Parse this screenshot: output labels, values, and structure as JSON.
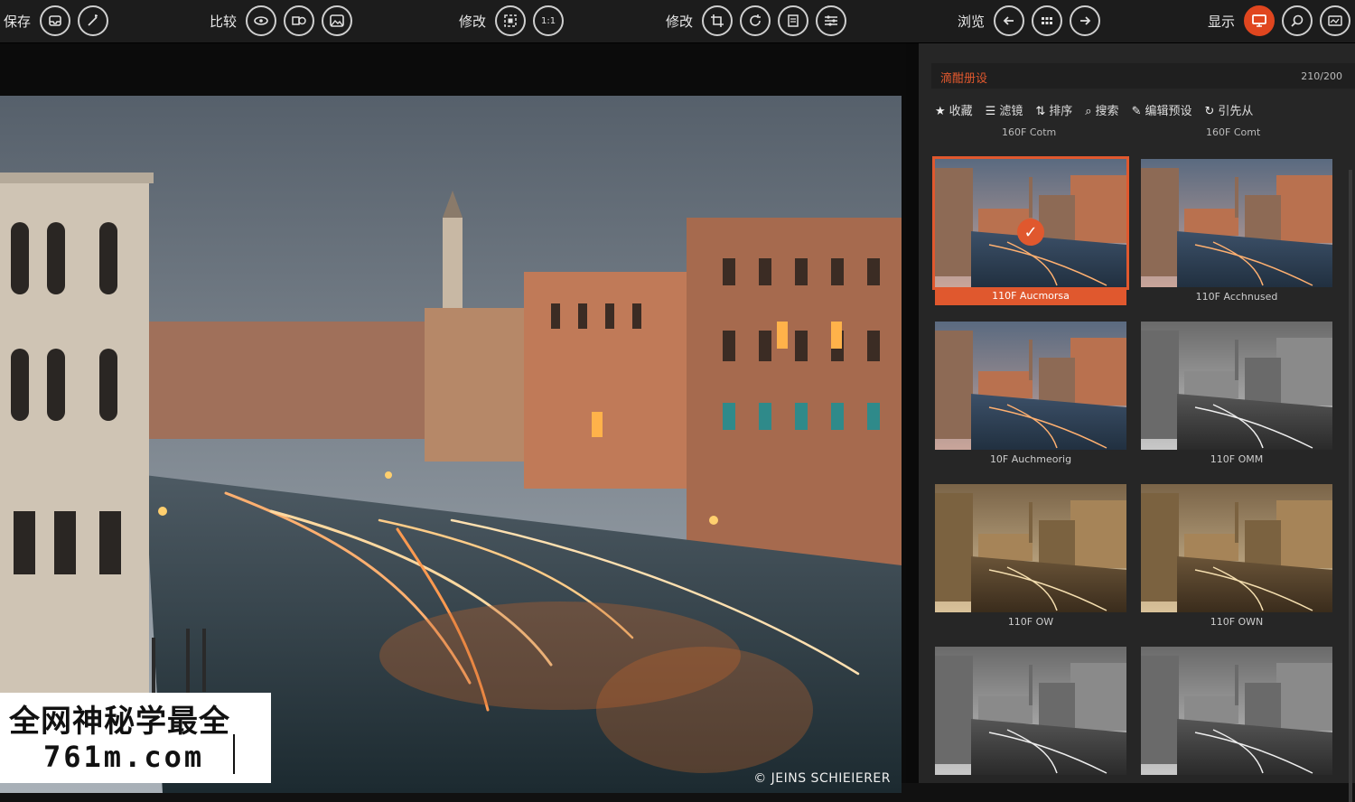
{
  "toolbar": {
    "groups": [
      {
        "label": "保存",
        "buttons": [
          "inbox-icon",
          "wand-icon"
        ]
      },
      {
        "label": "比较",
        "buttons": [
          "eye-icon",
          "compare-icon",
          "image-icon"
        ]
      },
      {
        "label": "修改",
        "buttons": [
          "crop-frame-icon",
          "ratio-icon"
        ]
      },
      {
        "label": "修改",
        "buttons": [
          "crop-icon",
          "rotate-icon",
          "layers-icon",
          "sliders-icon"
        ]
      },
      {
        "label": "浏览",
        "buttons": [
          "arrow-left-icon",
          "grid-icon",
          "arrow-right-icon"
        ]
      },
      {
        "label": "显示",
        "buttons": [
          "monitor-icon",
          "zoom-icon",
          "filmstrip-icon"
        ]
      }
    ],
    "ratio_text": "1:1"
  },
  "viewer": {
    "credit": "© JEINS SCHIEIERER"
  },
  "watermark": {
    "line1": "全网神秘学最全",
    "line2": "761m.com"
  },
  "panel": {
    "title": "滴酣册设",
    "count": "210/200",
    "filters": [
      {
        "icon": "★",
        "label": "收藏"
      },
      {
        "icon": "☰",
        "label": "滤镜"
      },
      {
        "icon": "⇅",
        "label": "排序"
      },
      {
        "icon": "⌕",
        "label": "搜索"
      },
      {
        "icon": "✎",
        "label": "编辑预设"
      },
      {
        "icon": "↻",
        "label": "引先从"
      }
    ],
    "col_labels": [
      "160F Cotm",
      "160F Comt"
    ],
    "thumbs": [
      {
        "caption": "110F Aucmorsa",
        "style": "color",
        "selected": true
      },
      {
        "caption": "110F Acchnused",
        "style": "color",
        "selected": false
      },
      {
        "caption": "10F Auchmeorig",
        "style": "color",
        "selected": false
      },
      {
        "caption": "110F OMM",
        "style": "mono",
        "selected": false
      },
      {
        "caption": "110F OW",
        "style": "sepia",
        "selected": false
      },
      {
        "caption": "110F OWN",
        "style": "sepia",
        "selected": false
      },
      {
        "caption": "",
        "style": "mono",
        "selected": false
      },
      {
        "caption": "",
        "style": "mono",
        "selected": false
      }
    ]
  },
  "colors": {
    "accent": "#e0582e",
    "toolbar_bg": "#1c1c1c",
    "panel_bg": "#262626"
  }
}
